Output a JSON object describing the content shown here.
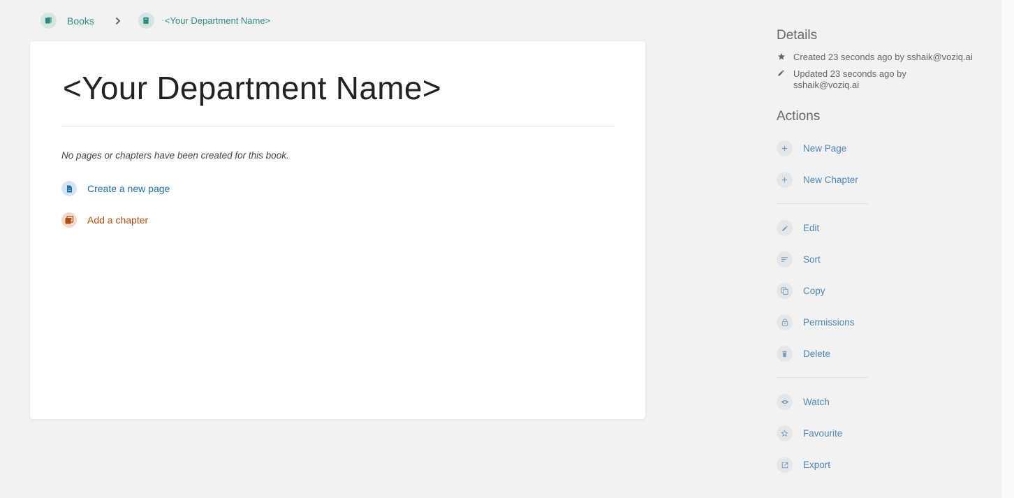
{
  "breadcrumb": {
    "books_label": "Books",
    "current_label": "<Your Department Name>"
  },
  "book": {
    "title": "<Your Department Name>",
    "empty_message": "No pages or chapters have been created for this book.",
    "create_page_label": "Create a new page",
    "add_chapter_label": "Add a chapter"
  },
  "details": {
    "heading": "Details",
    "created": "Created 23 seconds ago by sshaik@voziq.ai",
    "updated_line1": "Updated 23 seconds ago by",
    "updated_line2": "sshaik@voziq.ai"
  },
  "actions": {
    "heading": "Actions",
    "new_page": "New Page",
    "new_chapter": "New Chapter",
    "edit": "Edit",
    "sort": "Sort",
    "copy": "Copy",
    "permissions": "Permissions",
    "delete": "Delete",
    "watch": "Watch",
    "favourite": "Favourite",
    "export": "Export"
  },
  "colors": {
    "book_accent": "#2e8b7f",
    "page_accent": "#206ea7",
    "chapter_accent": "#af4d0d",
    "action_link": "#4d87b8"
  },
  "icons": {
    "breadcrumb_books": "books-icon",
    "breadcrumb_book": "book-icon",
    "breadcrumb_sep": "chevron-right-icon",
    "created": "star-icon",
    "updated": "pencil-icon",
    "new_page": "plus-icon",
    "new_chapter": "plus-icon",
    "edit": "pencil-icon",
    "sort": "sort-icon",
    "copy": "copy-icon",
    "permissions": "lock-icon",
    "delete": "trash-icon",
    "watch": "eye-icon",
    "favourite": "star-outline-icon",
    "export": "export-icon"
  }
}
